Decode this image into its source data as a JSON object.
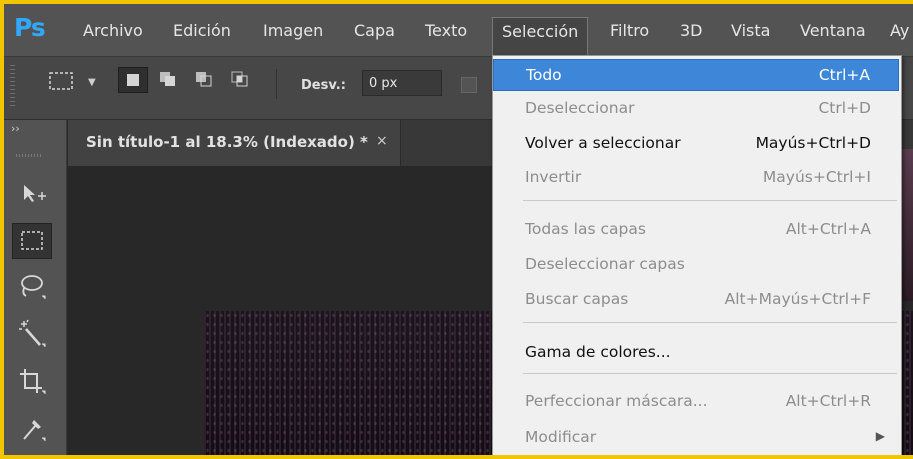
{
  "app": {
    "logo": "Ps"
  },
  "menubar": {
    "items": [
      "Archivo",
      "Edición",
      "Imagen",
      "Capa",
      "Texto",
      "Selección",
      "Filtro",
      "3D",
      "Vista",
      "Ventana",
      "Ay"
    ],
    "active": "Selección"
  },
  "options": {
    "desv_label": "Desv.:",
    "desv_value": "0 px"
  },
  "document_tab": {
    "title": "Sin título-1 al 18.3% (Indexado) *",
    "close": "×"
  },
  "toolbar": {
    "collapse": "››",
    "tools": [
      "move-tool-icon",
      "marquee-tool-icon",
      "lasso-tool-icon",
      "magic-wand-icon",
      "crop-tool-icon",
      "eyedropper-icon"
    ]
  },
  "selection_menu": {
    "items": [
      {
        "label": "Todo",
        "shortcut": "Ctrl+A",
        "state": "highlighted"
      },
      {
        "label": "Deseleccionar",
        "shortcut": "Ctrl+D",
        "state": "disabled"
      },
      {
        "label": "Volver a seleccionar",
        "shortcut": "Mayús+Ctrl+D",
        "state": "enabled"
      },
      {
        "label": "Invertir",
        "shortcut": "Mayús+Ctrl+I",
        "state": "disabled"
      },
      {
        "label": "Todas las capas",
        "shortcut": "Alt+Ctrl+A",
        "state": "disabled"
      },
      {
        "label": "Deseleccionar capas",
        "shortcut": "",
        "state": "disabled"
      },
      {
        "label": "Buscar capas",
        "shortcut": "Alt+Mayús+Ctrl+F",
        "state": "disabled"
      },
      {
        "label": "Gama de colores...",
        "shortcut": "",
        "state": "enabled"
      },
      {
        "label": "Perfeccionar máscara...",
        "shortcut": "Alt+Ctrl+R",
        "state": "disabled"
      },
      {
        "label": "Modificar",
        "shortcut": "",
        "state": "disabled",
        "submenu": true
      }
    ]
  },
  "colors": {
    "accent_highlight": "#3d86d8",
    "frame_border": "#f2c500",
    "logo": "#31a8ff"
  }
}
